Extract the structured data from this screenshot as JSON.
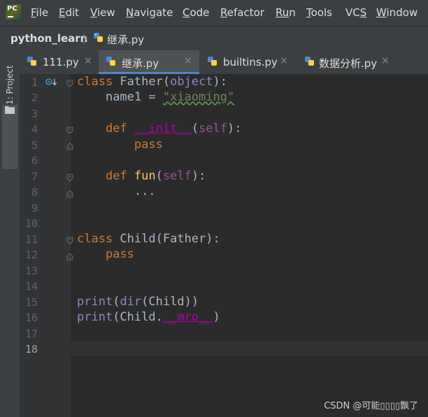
{
  "app": {
    "logo_text": "PC"
  },
  "menu": [
    {
      "mnemonic": "F",
      "rest": "ile"
    },
    {
      "mnemonic": "E",
      "rest": "dit"
    },
    {
      "mnemonic": "V",
      "rest": "iew"
    },
    {
      "mnemonic": "N",
      "rest": "avigate"
    },
    {
      "mnemonic": "C",
      "rest": "ode"
    },
    {
      "mnemonic": "R",
      "rest": "efactor"
    },
    {
      "mnemonic": "R",
      "rest": "u",
      "rest2": "n"
    },
    {
      "mnemonic": "T",
      "rest": "ools"
    },
    {
      "mnemonic": "",
      "rest": "VC",
      "mn2": "S"
    },
    {
      "mnemonic": "W",
      "rest": "indow"
    }
  ],
  "breadcrumb": {
    "project": "python_learn",
    "separator": "〉",
    "file": "继承.py"
  },
  "sidebar": {
    "project_tab": "1: Project"
  },
  "tabs": [
    {
      "label": "111.py",
      "close": "×"
    },
    {
      "label": "继承.py",
      "close": "×"
    },
    {
      "label": "builtins.py",
      "close": "×"
    },
    {
      "label": "数据分析.py",
      "close": "×"
    }
  ],
  "editor": {
    "line_numbers": [
      "1",
      "2",
      "3",
      "4",
      "5",
      "6",
      "7",
      "8",
      "9",
      "10",
      "11",
      "12",
      "13",
      "14",
      "15",
      "16",
      "17",
      "18"
    ],
    "current_line": "18",
    "code": {
      "l1": {
        "kw": "class",
        "name": " Father(",
        "base": "object",
        "end": "):"
      },
      "l2": {
        "indent": "    ",
        "var": "name1 = ",
        "str": "\"xiaoming\""
      },
      "l4": {
        "indent": "    ",
        "kw": "def",
        "sp": " ",
        "fn": "__init__",
        "open": "(",
        "self": "self",
        "close": "):"
      },
      "l5": {
        "indent": "        ",
        "kw": "pass"
      },
      "l7": {
        "indent": "    ",
        "kw": "def",
        "sp": " ",
        "fn": "fun",
        "open": "(",
        "self": "self",
        "close": "):"
      },
      "l8": {
        "indent": "        ",
        "text": "..."
      },
      "l11": {
        "kw": "class",
        "name": " Child(Father):"
      },
      "l12": {
        "indent": "    ",
        "kw": "pass"
      },
      "l15": {
        "fn": "print",
        "open": "(",
        "dir": "dir",
        "rest": "(Child))"
      },
      "l16": {
        "fn": "print",
        "open": "(Child.",
        "magic": "__mro__",
        "close": ")"
      }
    }
  },
  "watermark": "CSDN @可能▯▯▯▯飘了",
  "colors": {
    "keyword": "#cc7832",
    "builtin": "#8888c6",
    "self": "#94558d",
    "string": "#6a8759",
    "magic": "#b200b2",
    "function": "#ffc66d"
  }
}
